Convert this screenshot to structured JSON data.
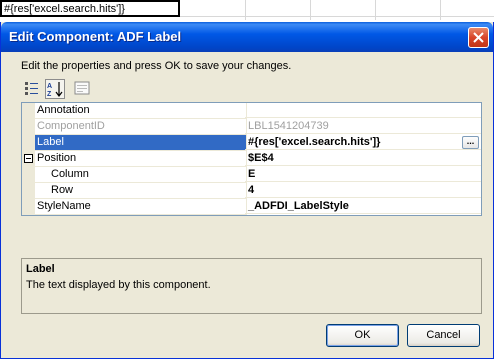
{
  "background_sheet": {
    "cell_text": "#{res['excel.search.hits']}"
  },
  "dialog": {
    "title": "Edit Component: ADF Label",
    "instructions": "Edit the properties and press OK to save your changes.",
    "toolbar": {
      "categorized_icon": "categorized-view-icon",
      "alphabetical_icon": "alphabetical-sort-icon",
      "property_pages_icon": "property-pages-icon"
    },
    "properties": [
      {
        "name": "Annotation",
        "value": ""
      },
      {
        "name": "ComponentID",
        "value": "LBL1541204739"
      },
      {
        "name": "Label",
        "value": "#{res['excel.search.hits']}",
        "ellipsis": "..."
      },
      {
        "name": "Position",
        "value": "$E$4"
      },
      {
        "name": "Column",
        "value": "E"
      },
      {
        "name": "Row",
        "value": "4"
      },
      {
        "name": "StyleName",
        "value": "_ADFDI_LabelStyle"
      }
    ],
    "description": {
      "title": "Label",
      "text": "The text displayed by this component."
    },
    "ok_label": "OK",
    "cancel_label": "Cancel"
  },
  "colors": {
    "titlebar": "#0058e6",
    "selection": "#316ac5",
    "dialog_bg": "#ece9d8"
  }
}
